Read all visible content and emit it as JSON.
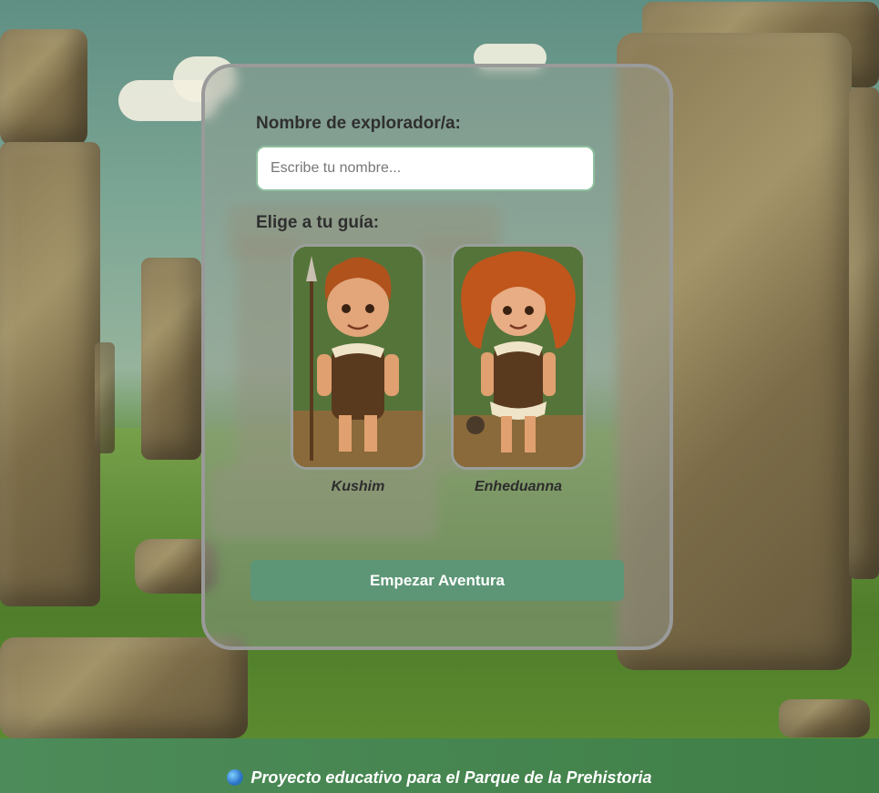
{
  "form": {
    "name_label": "Nombre de explorador/a:",
    "name_placeholder": "Escribe tu nombre...",
    "name_value": "",
    "guide_label": "Elige a tu guía:",
    "guides": [
      {
        "name": "Kushim"
      },
      {
        "name": "Enheduanna"
      }
    ],
    "start_button": "Empezar Aventura"
  },
  "footer": {
    "icon": "globe-icon",
    "text": "Proyecto educativo para el Parque de la Prehistoria"
  },
  "colors": {
    "button": "#5d9677",
    "footer": "#3f7f46",
    "input_border": "#8fbf9e"
  }
}
